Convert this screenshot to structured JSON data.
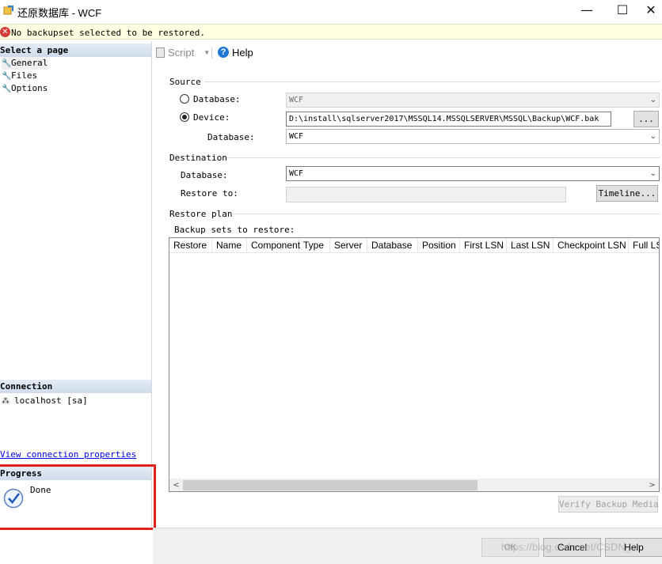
{
  "window": {
    "title": "还原数据库 - WCF",
    "minimize": "—",
    "maximize": "☐",
    "close": "✕"
  },
  "error": {
    "message": "No backupset selected to be restored."
  },
  "left_pane": {
    "select_page_header": "Select a page",
    "pages": [
      "General",
      "Files",
      "Options"
    ],
    "connection_header": "Connection",
    "connection_value": "localhost [sa]",
    "view_connection_link": "View connection properties",
    "progress_header": "Progress",
    "progress_status": "Done"
  },
  "toolbar": {
    "script_label": "Script",
    "help_label": "Help"
  },
  "source": {
    "section_label": "Source",
    "database_option": "Database:",
    "database_value": "WCF",
    "device_option": "Device:",
    "device_value": "D:\\install\\sqlserver2017\\MSSQL14.MSSQLSERVER\\MSSQL\\Backup\\WCF.bak",
    "browse_label": "...",
    "device_database_label": "Database:",
    "device_database_value": "WCF",
    "selected": "device"
  },
  "destination": {
    "section_label": "Destination",
    "database_label": "Database:",
    "database_value": "WCF",
    "restore_to_label": "Restore to:",
    "restore_to_value": "",
    "timeline_label": "Timeline..."
  },
  "restore_plan": {
    "section_label": "Restore plan",
    "backup_sets_label": "Backup sets to restore:",
    "columns": [
      "Restore",
      "Name",
      "Component",
      "Type",
      "Server",
      "Database",
      "Position",
      "First LSN",
      "Last LSN",
      "Checkpoint LSN",
      "Full LS"
    ],
    "rows": []
  },
  "buttons": {
    "verify": "Verify Backup Media",
    "ok": "OK",
    "cancel": "Cancel",
    "help": "Help"
  },
  "watermark": "https://blog.csdn.net/CSDN_"
}
